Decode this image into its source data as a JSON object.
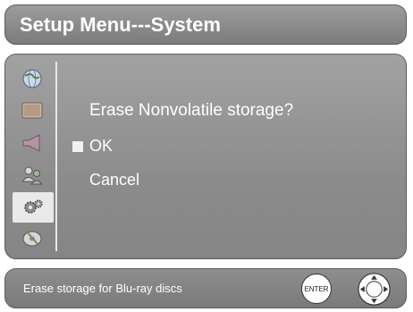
{
  "title": "Setup Menu---System",
  "sidebar": {
    "items": [
      {
        "icon": "globe-icon"
      },
      {
        "icon": "display-icon"
      },
      {
        "icon": "speaker-icon"
      },
      {
        "icon": "parental-users-icon"
      },
      {
        "icon": "gears-icon",
        "active": true
      },
      {
        "icon": "disc-icon"
      }
    ]
  },
  "dialog": {
    "question": "Erase Nonvolatile storage?",
    "options": [
      "OK",
      "Cancel"
    ],
    "selected": "OK"
  },
  "status": {
    "text": "Erase storage for Blu-ray discs",
    "enter_label": "ENTER"
  }
}
